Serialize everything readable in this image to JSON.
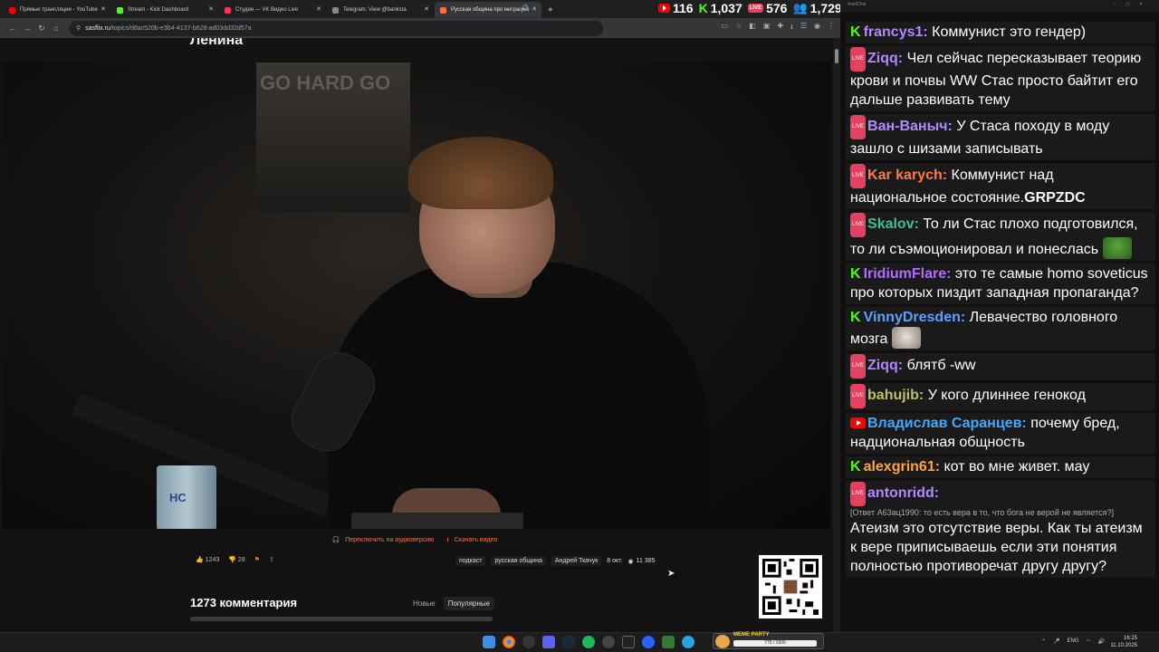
{
  "tabs": [
    {
      "title": "Прямые трансляции - YouTube",
      "color": "#ff0000",
      "active": false
    },
    {
      "title": "Stream - Kick Dashboard",
      "color": "#53fc18",
      "active": false
    },
    {
      "title": "Студия — VK Видео Live",
      "color": "#ff3355",
      "active": false
    },
    {
      "title": "Telegram: View @banksta",
      "color": "#888888",
      "active": false
    },
    {
      "title": "Русская община про миграцию",
      "color": "#ff6f3d",
      "active": true
    }
  ],
  "counters": {
    "youtube": "116",
    "kick": "1,037",
    "vk": "576",
    "total": "1,729"
  },
  "address": {
    "host": "sasflix.ru",
    "path": "/topics/d8ac520b-e3b4-4137-b628-ad03dd32d57a"
  },
  "page": {
    "title": "Ленина",
    "poster_text": "GO HARD GO",
    "mug_text": "HC",
    "actions": {
      "audio": "Переключить на аудиоверсию",
      "download": "Скачать видео"
    },
    "likes": "1243",
    "dislikes": "28",
    "tags": [
      "подкаст",
      "русская община",
      "Андрей Ткачук"
    ],
    "date": "8 окт.",
    "views": "11 385",
    "comments_title": "1273 комментария",
    "sort_new": "Новые",
    "sort_popular": "Популярные"
  },
  "chat": {
    "window_title": "AxelChat",
    "messages": [
      {
        "platform": "kick",
        "name": "francys1:",
        "color": "#b388ff",
        "text": "Коммунист это гендер)"
      },
      {
        "platform": "vk",
        "name": "Ziqq:",
        "color": "#b388ff",
        "text": "Чел сейчас пересказывает теорию крови и почвы WW Стас просто байтит его дальше развивать тему"
      },
      {
        "platform": "vk",
        "name": "Ван-Ваныч:",
        "color": "#b388ff",
        "text": "У Стаса походу в моду зашло с шизами записывать"
      },
      {
        "platform": "vk",
        "name": "Kar karych:",
        "color": "#ff7a45",
        "text": "Коммунист над национальное состояние.",
        "strong": "GRPZDC"
      },
      {
        "platform": "vk",
        "name": "Skalov:",
        "color": "#37c28a",
        "text": "То ли Стас плохо подготовился, то ли съэмоционировал и понеслась",
        "emote": "frog"
      },
      {
        "platform": "kick",
        "name": "IridiumFlare:",
        "color": "#b36bff",
        "text": "это те самые homo soveticus про которых пиздит западная пропаганда?"
      },
      {
        "platform": "kick",
        "name": "VinnyDresden:",
        "color": "#5aa0ff",
        "text": "Левачество головного мозга",
        "emote": "cat"
      },
      {
        "platform": "vk",
        "name": "Ziqq:",
        "color": "#b388ff",
        "text": "блятб -ww"
      },
      {
        "platform": "vk",
        "name": "bahujib:",
        "color": "#c0c060",
        "text": "У кого длиннее генокод"
      },
      {
        "platform": "youtube",
        "name": "Владислав Саранцев:",
        "color": "#3fa9ff",
        "text": "почему бред, надциональная общность"
      },
      {
        "platform": "kick",
        "name": "alexgrin61:",
        "color": "#ffa53c",
        "text": "кот во мне живет. мау"
      },
      {
        "platform": "vk",
        "name": "antonridd:",
        "color": "#b388ff",
        "text": "",
        "reply": "[Ответ A63ац1990: то есть вера в то, что бога не верой не является?]",
        "body": "Атеизм это отсутствие веры. Как ты атеизм к вере приписываешь если эти понятия полностью противоречат другу другу?"
      }
    ]
  },
  "taskbar": {
    "meme_label": "MEME PARTY",
    "meme_progress": "775 / 1500",
    "lang": "ENG",
    "time": "16:25",
    "date": "11.10.2025"
  }
}
